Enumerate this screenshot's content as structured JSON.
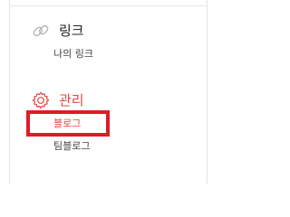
{
  "link_section": {
    "title": "링크",
    "icon": "link-icon",
    "items": [
      {
        "label": "나의 링크"
      }
    ]
  },
  "manage_section": {
    "title": "관리",
    "icon": "gear-icon",
    "accent_color": "#e0473f",
    "items": [
      {
        "label": "블로그",
        "active": true
      },
      {
        "label": "팀블로그"
      }
    ]
  },
  "highlight_color": "#e01b26"
}
